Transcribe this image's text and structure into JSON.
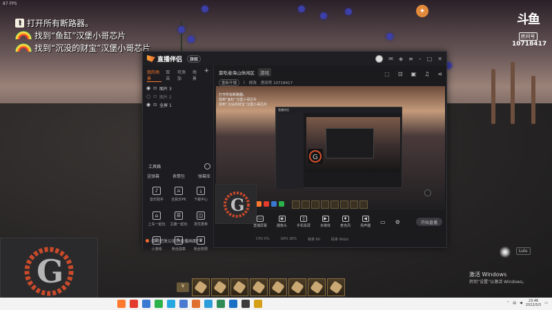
{
  "overlay": {
    "fps": "87 FPS",
    "quests": [
      {
        "icon": "!",
        "text": "打开所有断路器。"
      },
      {
        "icon": "rainbow",
        "text": "找到“鱼缸”汉堡小哥芯片"
      },
      {
        "icon": "rainbow",
        "text": "找到“沉没的财宝”汉堡小哥芯片"
      }
    ],
    "room_mark": "斗鱼",
    "room_tag": "房间号",
    "room_id": "10718417"
  },
  "app": {
    "name": "直播伴侣",
    "badge": "旗舰",
    "left_tabs": [
      "我的场景",
      "双击",
      "可添加",
      "场景"
    ],
    "scenes": [
      {
        "name": "图片 3",
        "dim": false
      },
      {
        "name": "图片 2",
        "dim": true
      },
      {
        "name": "全屏 1",
        "dim": false
      }
    ],
    "toolbox_label": "工具箱",
    "toolbox_row": [
      "送弹幕",
      "表情包",
      "弹幕库"
    ],
    "tools": [
      {
        "label": "音乐助手",
        "icon": "♪"
      },
      {
        "label": "全民乐PK",
        "icon": "⚔"
      },
      {
        "label": "下载中心",
        "icon": "⤓"
      },
      {
        "label": "上车一起玩",
        "icon": "⌂"
      },
      {
        "label": "主播一起玩",
        "icon": "☰"
      },
      {
        "label": "发优惠券",
        "icon": "◫"
      },
      {
        "label": "小游戏",
        "icon": "⊡"
      },
      {
        "label": "粉丝勋章",
        "icon": "✎"
      },
      {
        "label": "粉丝权限",
        "icon": "♛"
      }
    ],
    "room_title": "莫吃者海山休闲区",
    "room_tag": "游戏",
    "room_sub": [
      "重新开播",
      "|",
      "修改",
      "房间号 10718417"
    ],
    "controls": [
      {
        "label": "直播屏幕",
        "icon": "▭"
      },
      {
        "label": "摄像头",
        "icon": "◉"
      },
      {
        "label": "手机投屏",
        "icon": "▯"
      },
      {
        "label": "多媒体",
        "icon": "▶"
      },
      {
        "label": "麦克风",
        "icon": "♦"
      },
      {
        "label": "扬声器",
        "icon": "◀"
      }
    ],
    "live_button": "开始直播",
    "status": [
      "CPU 5%",
      "GPU 26%",
      "帧率 60",
      "码率 0kb/s"
    ],
    "footer_text": "如何把发公安助直播画面？",
    "preview_quests": [
      "打开所有断路器。",
      "找到“鱼缸”汉堡小哥芯片",
      "找到“沉没的财宝”汉堡小哥芯片"
    ]
  },
  "watermark": {
    "title": "激活 Windows",
    "sub": "转到“设置”以激活 Windows。",
    "tag": "Lulu"
  },
  "taskbar": {
    "time": "23:46",
    "date": "2022/5/5",
    "icons": [
      "#ff7a2e",
      "#e33b2e",
      "#3a78d1",
      "#2bb24c",
      "#26a7e0",
      "#4a7bd1",
      "#e07030",
      "#2d9cdb",
      "#2e8b57",
      "#1a6fc4",
      "#3c3c3c",
      "#d4a017"
    ]
  }
}
